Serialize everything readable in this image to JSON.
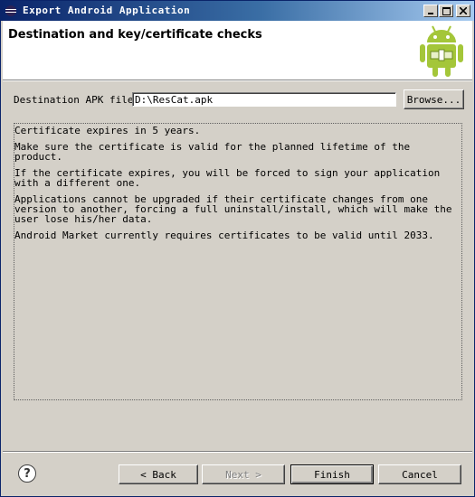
{
  "window": {
    "title": "Export Android Application"
  },
  "header": {
    "title": "Destination and key/certificate checks"
  },
  "destination": {
    "label": "Destination APK file:",
    "value": "D:\\ResCat.apk",
    "browse_label": "Browse..."
  },
  "messages": [
    "Certificate expires in 5 years.",
    "Make sure the certificate is valid for the planned lifetime of the product.",
    "If the certificate expires, you will be forced to sign your application with a different one.",
    "Applications cannot be upgraded if their certificate changes from one version to another, forcing a full uninstall/install, which will make the user lose his/her data.",
    "Android Market currently requires certificates to be valid until 2033."
  ],
  "footer": {
    "back_label": "< Back",
    "next_label": "Next >",
    "finish_label": "Finish",
    "cancel_label": "Cancel"
  },
  "colors": {
    "titlebar": "#0a246a",
    "android_green": "#a4c639",
    "dialog_bg": "#d4d0c8"
  },
  "icons": [
    "eclipse-icon",
    "minimize-icon",
    "maximize-icon",
    "close-icon",
    "android-logo-icon",
    "help-icon"
  ]
}
